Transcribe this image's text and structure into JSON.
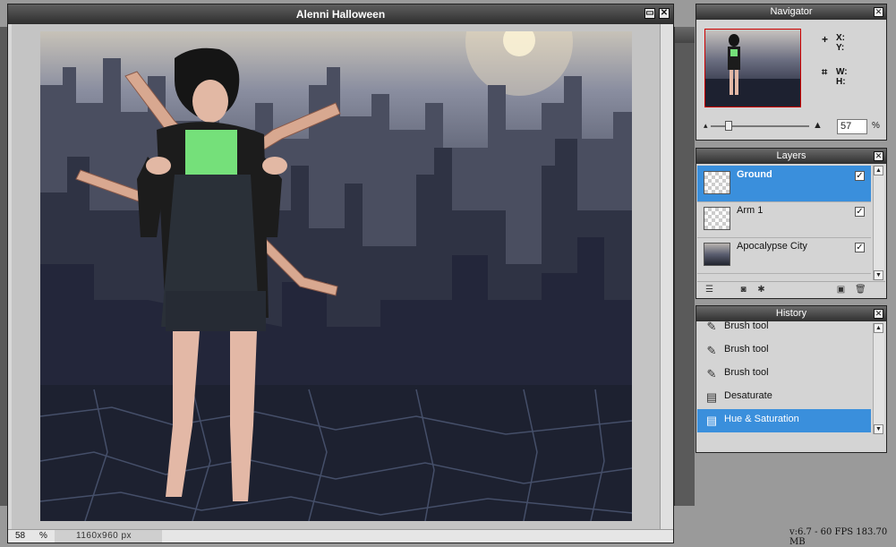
{
  "document": {
    "title": "Alenni Halloween",
    "zoom_value": "58",
    "zoom_unit": "%",
    "dimensions": "1160x960 px"
  },
  "navigator": {
    "title": "Navigator",
    "x_label": "X:",
    "y_label": "Y:",
    "w_label": "W:",
    "h_label": "H:",
    "zoom_value": "57",
    "zoom_unit": "%"
  },
  "layers": {
    "title": "Layers",
    "items": [
      {
        "name": "Ground",
        "visible": true,
        "selected": true
      },
      {
        "name": "Arm 1",
        "visible": true,
        "selected": false
      },
      {
        "name": "Apocalypse City",
        "visible": true,
        "selected": false
      }
    ]
  },
  "history": {
    "title": "History",
    "items": [
      {
        "label": "Brush tool",
        "icon": "brush-icon"
      },
      {
        "label": "Brush tool",
        "icon": "brush-icon"
      },
      {
        "label": "Brush tool",
        "icon": "brush-icon"
      },
      {
        "label": "Desaturate",
        "icon": "adjustment-icon"
      },
      {
        "label": "Hue & Saturation",
        "icon": "adjustment-icon",
        "selected": true
      }
    ]
  },
  "status": {
    "text": "v:6.7 - 60 FPS 183.70 MB"
  },
  "colors": {
    "selection": "#3a8fdc",
    "titlebar": "#3a3a3a",
    "panel_bg": "#d4d4d4"
  }
}
